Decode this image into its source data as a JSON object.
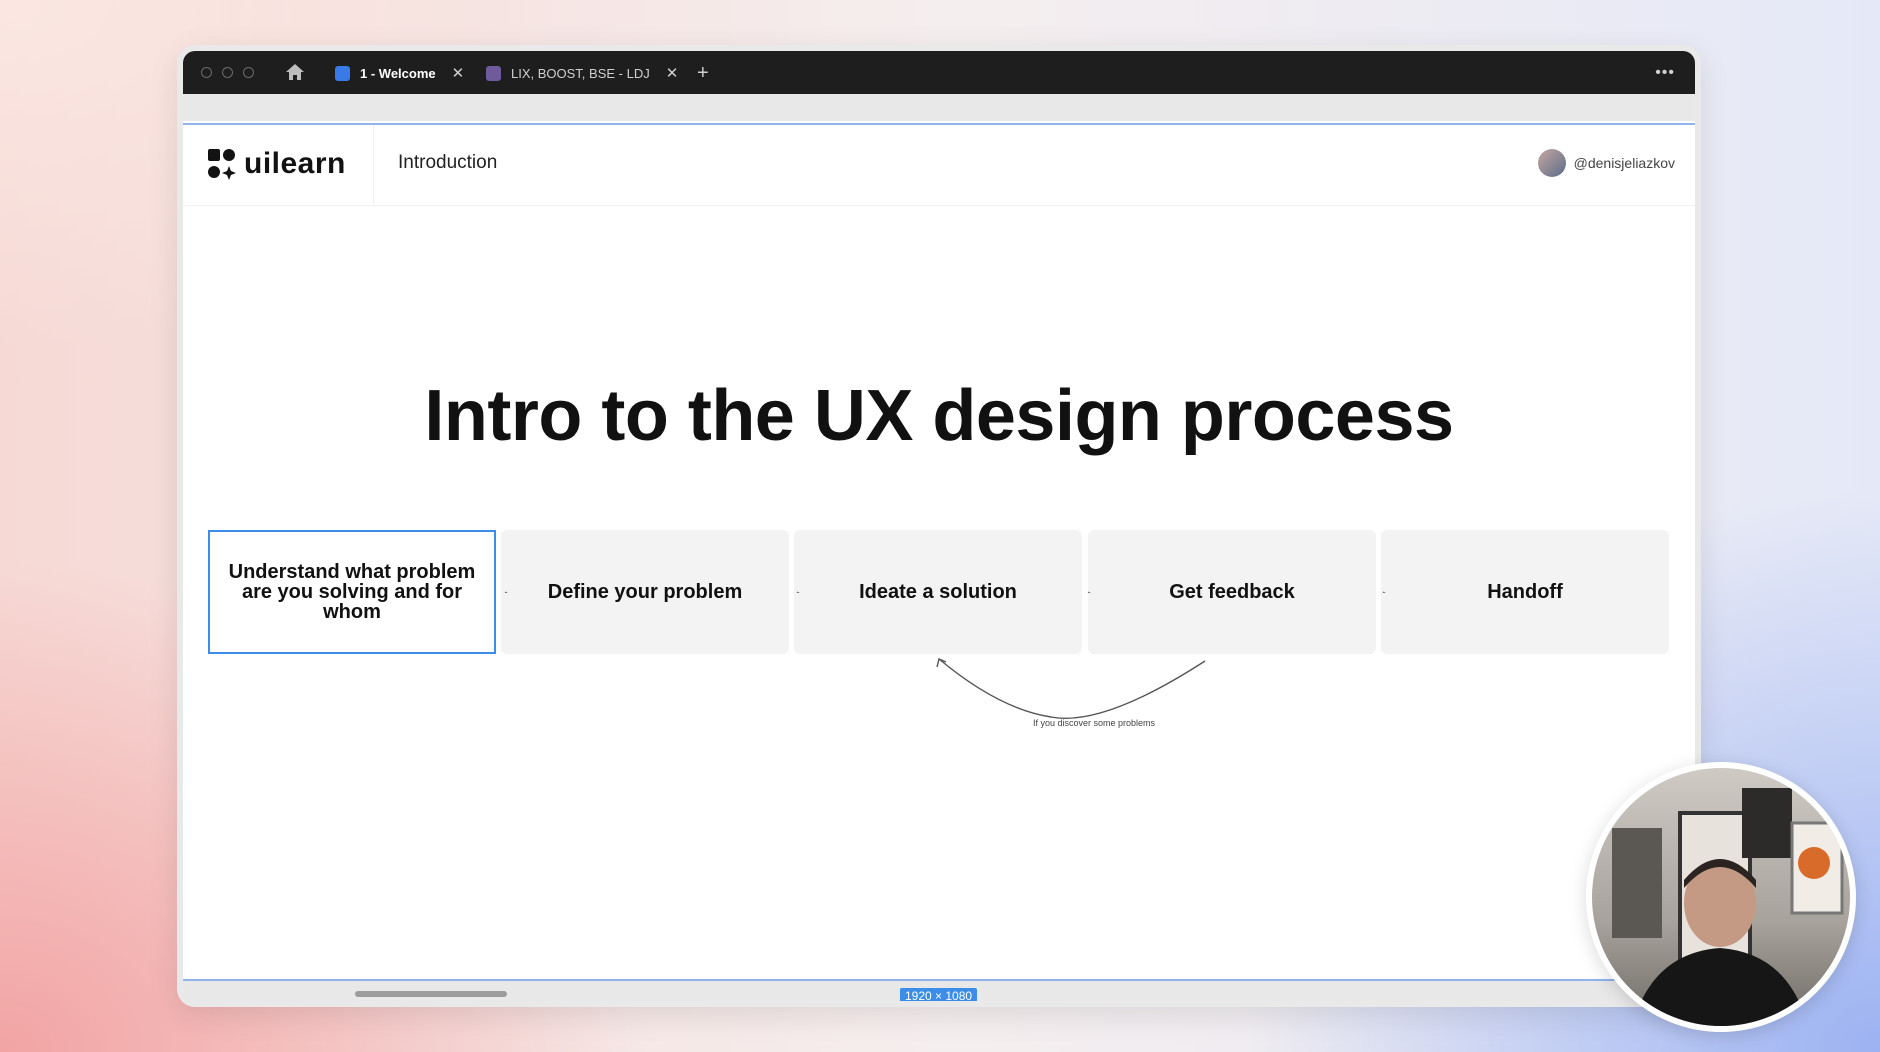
{
  "tabs": [
    {
      "label": "1 - Welcome",
      "active": true,
      "icon": "figma-file-icon",
      "icon_color": "#3a79e8"
    },
    {
      "label": "LIX, BOOST, BSE - LDJ",
      "active": false,
      "icon": "figjam-file-icon",
      "icon_color": "#6f5a9c"
    }
  ],
  "tab_close_glyph": "✕",
  "new_tab_glyph": "+",
  "menu_glyph": "•••",
  "app": {
    "logo_text": "uilearn",
    "section": "Introduction",
    "username": "@denisjeliazkov"
  },
  "slide": {
    "title": "Intro to the UX design process",
    "steps": [
      "Understand what problem are you solving and for whom",
      "Define your problem",
      "Ideate a solution",
      "Get feedback",
      "Handoff"
    ],
    "loop_label": "If you discover some problems"
  },
  "frame_size": "1920 × 1080",
  "colors": {
    "accent": "#3b8de8",
    "titlebar": "#1e1e1e",
    "step_bg": "#f3f3f3"
  }
}
